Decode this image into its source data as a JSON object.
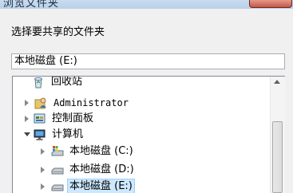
{
  "window": {
    "title": "浏览文件夹"
  },
  "instruction": "选择要共享的文件夹",
  "path_field": {
    "value": "本地磁盘 (E:)"
  },
  "tree": {
    "items": [
      {
        "label": "回收站",
        "icon": "recycle-bin-icon",
        "expander": "none"
      },
      {
        "label": "Administrator",
        "icon": "user-folder-icon",
        "expander": "collapsed"
      },
      {
        "label": "控制面板",
        "icon": "control-panel-icon",
        "expander": "collapsed"
      },
      {
        "label": "计算机",
        "icon": "computer-icon",
        "expander": "expanded"
      },
      {
        "label": "本地磁盘 (C:)",
        "icon": "system-drive-icon",
        "expander": "collapsed"
      },
      {
        "label": "本地磁盘 (D:)",
        "icon": "drive-icon",
        "expander": "collapsed"
      },
      {
        "label": "本地磁盘 (E:)",
        "icon": "drive-icon",
        "expander": "collapsed",
        "selected": true
      }
    ]
  },
  "colors": {
    "selection": "#cce8ff",
    "title_bar": "#b8d0ea",
    "close_button": "#c75646"
  }
}
